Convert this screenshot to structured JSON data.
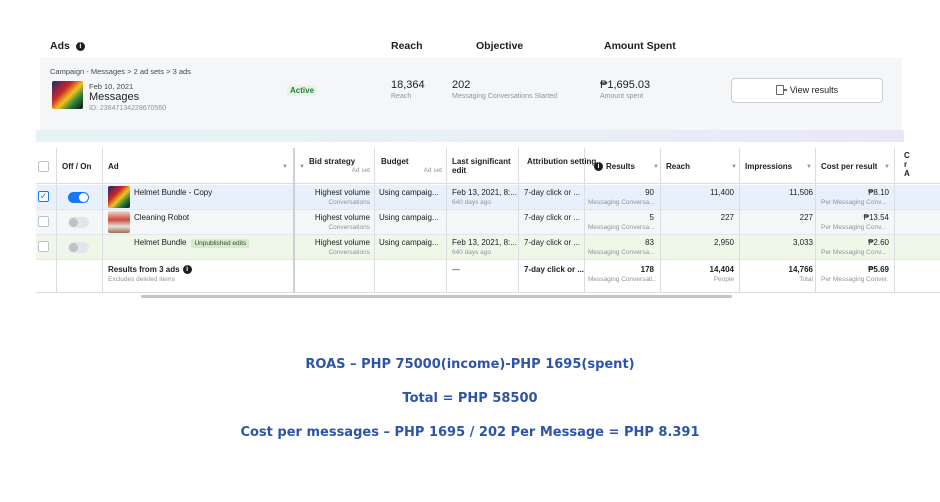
{
  "summary": {
    "headers": {
      "ads": "Ads",
      "reach": "Reach",
      "objective": "Objective",
      "amount_spent": "Amount Spent"
    },
    "breadcrumb": "Campaign - Messages > 2 ad sets > 3 ads",
    "campaign": {
      "date": "Feb 10, 2021",
      "name": "Messages",
      "id": "ID: 23847134228670560"
    },
    "status": "Active",
    "reach": {
      "value": "18,364",
      "label": "Reach"
    },
    "objective": {
      "value": "202",
      "label": "Messaging Conversations Started"
    },
    "amount": {
      "value": "₱1,695.03",
      "label": "Amount spent"
    },
    "view_results": "View results"
  },
  "table": {
    "headers": {
      "offon": "Off / On",
      "ad": "Ad",
      "bid": "Bid strategy",
      "bid_sub": "Ad set",
      "budget": "Budget",
      "budget_sub": "Ad set",
      "last_edit": "Last significant edit",
      "attribution": "Attribution setting",
      "results": "Results",
      "reach": "Reach",
      "impressions": "Impressions",
      "cpr": "Cost per result",
      "extra": "C r A"
    },
    "rows": [
      {
        "checked": true,
        "on": true,
        "name": "Helmet Bundle - Copy",
        "unpublished": "",
        "bid": "Highest volume",
        "bid_sub": "Conversations",
        "budget": "Using campaig...",
        "edit": "Feb 13, 2021, 8:...",
        "edit_sub": "640 days ago",
        "attr": "7-day click or ...",
        "results": "90",
        "results_sub": "Messaging Conversa...",
        "reach": "11,400",
        "impr": "11,506",
        "cpr": "₱8.10",
        "cpr_sub": "Per Messaging Conv..."
      },
      {
        "checked": false,
        "on": false,
        "name": "Cleaning Robot",
        "unpublished": "",
        "bid": "Highest volume",
        "bid_sub": "Conversations",
        "budget": "Using campaig...",
        "edit": "",
        "edit_sub": "",
        "attr": "7-day click or ...",
        "results": "5",
        "results_sub": "Messaging Conversa...",
        "reach": "227",
        "impr": "227",
        "cpr": "₱13.54",
        "cpr_sub": "Per Messaging Conv..."
      },
      {
        "checked": false,
        "on": false,
        "name": "Helmet Bundle",
        "unpublished": "Unpublished edits",
        "bid": "Highest volume",
        "bid_sub": "Conversations",
        "budget": "Using campaig...",
        "edit": "Feb 13, 2021, 8:...",
        "edit_sub": "640 days ago",
        "attr": "7-day click or ...",
        "results": "83",
        "results_sub": "Messaging Conversa...",
        "reach": "2,950",
        "impr": "3,033",
        "cpr": "₱2.60",
        "cpr_sub": "Per Messaging Conv..."
      }
    ],
    "totals": {
      "label": "Results from 3 ads",
      "sub": "Excludes deleted items",
      "edit": "—",
      "attr": "7-day click or ...",
      "results": "178",
      "results_sub": "Messaging Conversati...",
      "reach": "14,404",
      "reach_sub": "People",
      "impr": "14,766",
      "impr_sub": "Total",
      "cpr": "₱5.69",
      "cpr_sub": "Per Messaging Conver..."
    }
  },
  "notes": {
    "roas": "ROAS – PHP 75000(income)-PHP 1695(spent)",
    "total": "Total = PHP 58500",
    "cost": "Cost per messages – PHP 1695 / 202 Per Message = PHP 8.391"
  },
  "colors": {
    "accent": "#1877f2",
    "notes": "#2e54a8",
    "active": "#2a7d3b"
  }
}
